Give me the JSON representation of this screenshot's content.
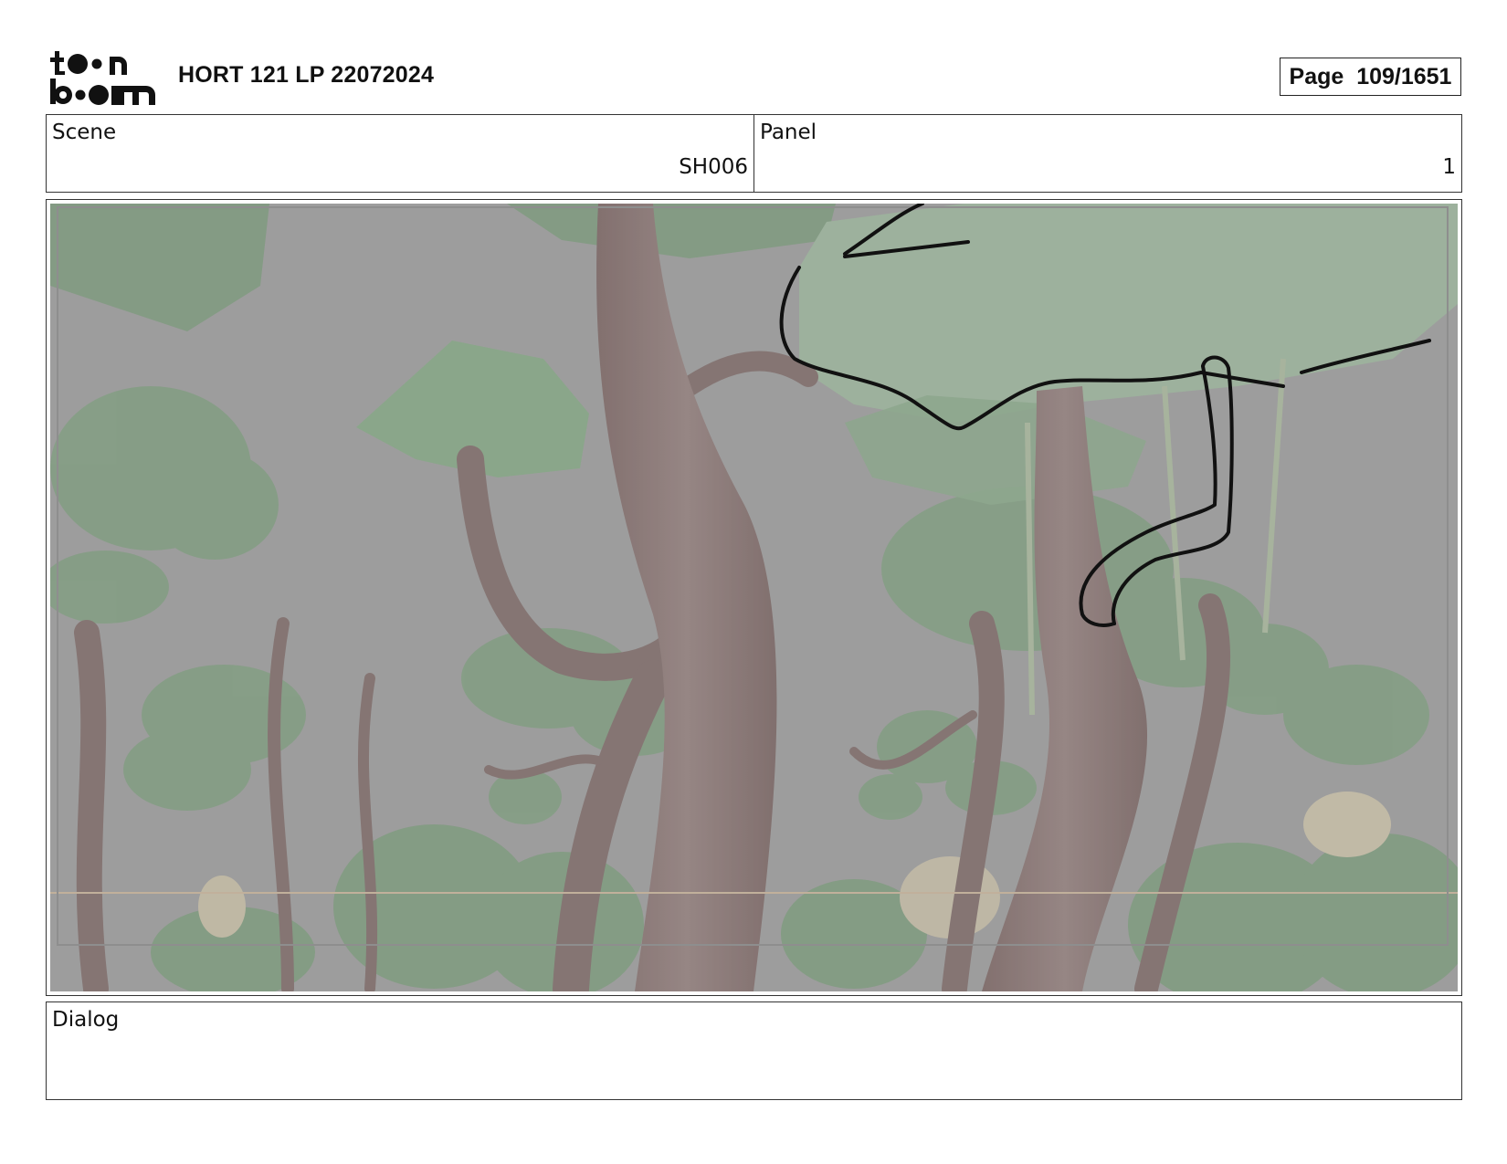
{
  "header": {
    "logo_text": "toon boom",
    "project_title": "HORT 121 LP 22072024",
    "page_label": "Page",
    "page_value": "109/1651"
  },
  "info": {
    "scene_label": "Scene",
    "scene_value": "SH006",
    "panel_label": "Panel",
    "panel_value": "1"
  },
  "panel_image": {
    "icon": "storyboard-panel-jungle-drawing",
    "colors": {
      "sky": "#9e9e9e",
      "foliage": "#7ea07e",
      "trunk": "#8a7472",
      "ink": "#111111"
    }
  },
  "dialog": {
    "label": "Dialog",
    "text": ""
  }
}
